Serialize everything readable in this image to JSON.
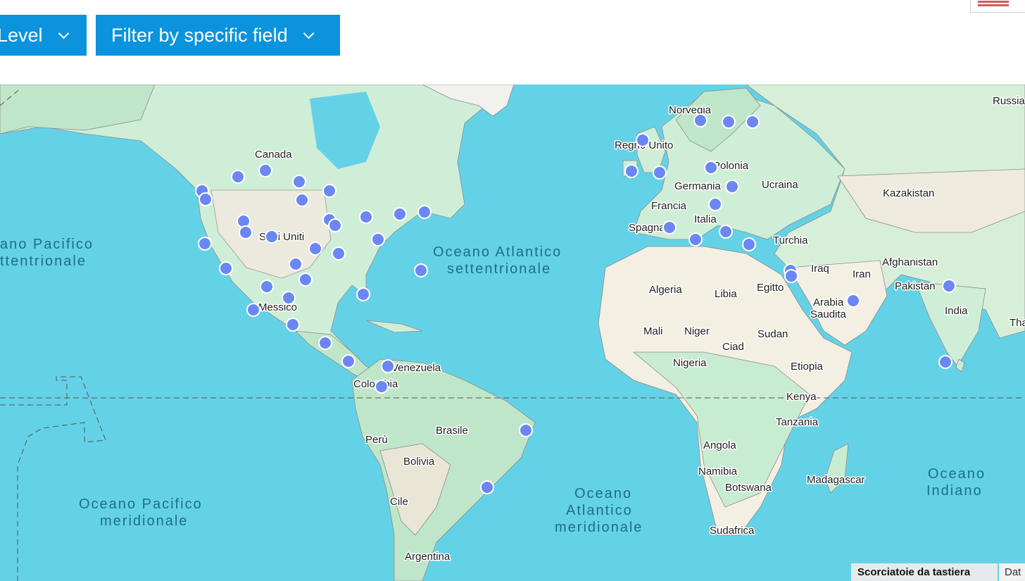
{
  "filters": {
    "level_label": "Level",
    "field_label": "Filter by specific field"
  },
  "map": {
    "land_labels": [
      "Canada",
      "Stati Uniti",
      "Messico",
      "Venezuela",
      "Colombia",
      "Perù",
      "Brasile",
      "Bolivia",
      "Cile",
      "Argentina",
      "Norvegia",
      "Regno Unito",
      "Polonia",
      "Germania",
      "Francia",
      "Spagna",
      "Italia",
      "Ucraina",
      "Russia",
      "Kazakistan",
      "Turchia",
      "Iraq",
      "Iran",
      "Afghanistan",
      "Pakistan",
      "India",
      "Tha",
      "Algeria",
      "Libia",
      "Egitto",
      "Arabia",
      "Saudita",
      "Mali",
      "Niger",
      "Sudan",
      "Ciad",
      "Nigeria",
      "Etiopia",
      "Kenya",
      "Tanzania",
      "Angola",
      "Namibia",
      "Botswana",
      "Madagascar",
      "Sudafrica"
    ],
    "ocean_labels": [
      "ano Pacifico",
      "ttentrionale",
      "Oceano Atlantico",
      "settentrionale",
      "Oceano Pacifico",
      "meridionale",
      "Oceano",
      "Atlantico",
      "meridionale",
      "Oceano",
      "Indiano"
    ],
    "marker_color": "#6b87f5",
    "marker_count": 50
  },
  "attribution": {
    "shortcuts": "Scorciatoie da tastiera",
    "data": "Dat"
  }
}
